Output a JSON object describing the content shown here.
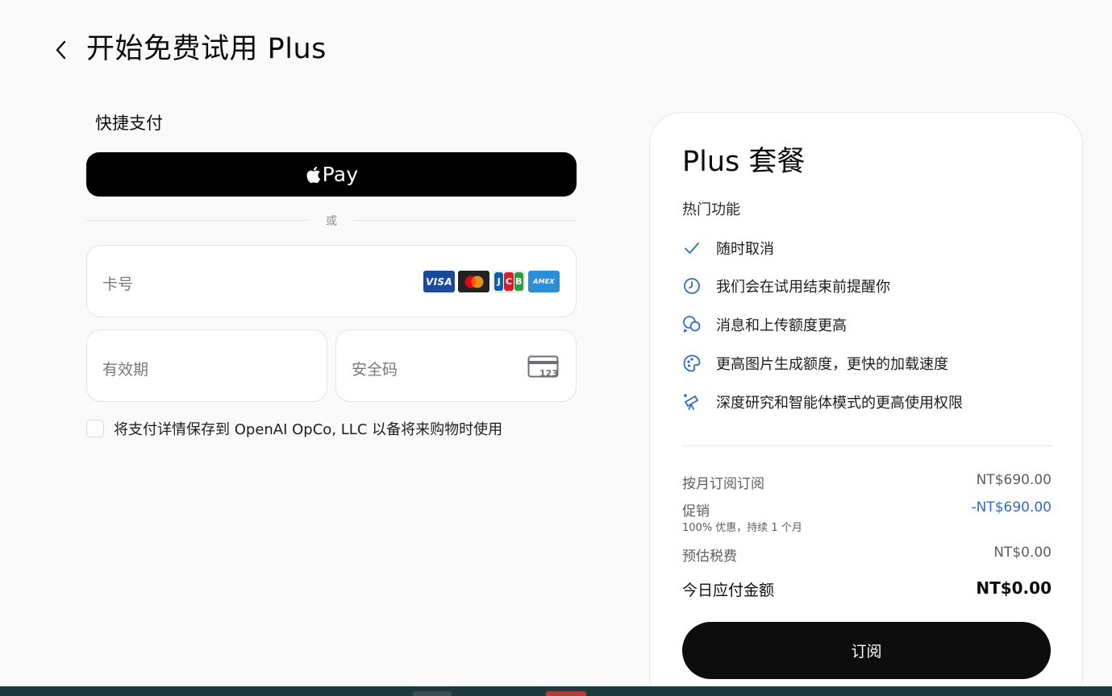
{
  "header": {
    "title": "开始免费试用 Plus"
  },
  "express": {
    "label": "快捷支付",
    "apple_pay_label": "Pay"
  },
  "divider": {
    "or_text": "或"
  },
  "card_form": {
    "card_number_placeholder": "卡号",
    "brands": [
      "VISA",
      "Mastercard",
      "JCB",
      "AMEX"
    ],
    "expiry_placeholder": "有效期",
    "cvc_placeholder": "安全码",
    "cvc_icon_text": "123",
    "save_label": "将支付详情保存到 OpenAI OpCo, LLC 以备将来购物时使用",
    "save_checked": false
  },
  "summary": {
    "plan_title": "Plus 套餐",
    "features_heading": "热门功能",
    "features": [
      {
        "icon": "check-icon",
        "text": "随时取消"
      },
      {
        "icon": "clock-icon",
        "text": "我们会在试用结束前提醒你"
      },
      {
        "icon": "chat-bubbles-icon",
        "text": "消息和上传额度更高"
      },
      {
        "icon": "image-gen-icon",
        "text": "更高图片生成额度，更快的加载速度"
      },
      {
        "icon": "telescope-icon",
        "text": "深度研究和智能体模式的更高使用权限"
      }
    ],
    "line_items": {
      "monthly": {
        "label": "按月订阅订阅",
        "value": "NT$690.00"
      },
      "promo": {
        "label": "促销",
        "sub": "100% 优惠，持续 1 个月",
        "value": "-NT$690.00"
      },
      "tax": {
        "label": "预估税费",
        "value": "NT$0.00"
      },
      "total": {
        "label": "今日应付金额",
        "value": "NT$0.00"
      }
    },
    "subscribe_label": "订阅"
  },
  "colors": {
    "accent_blue": "#2f6cc8",
    "button_black": "#0d0d0d",
    "background": "#fafafb"
  }
}
